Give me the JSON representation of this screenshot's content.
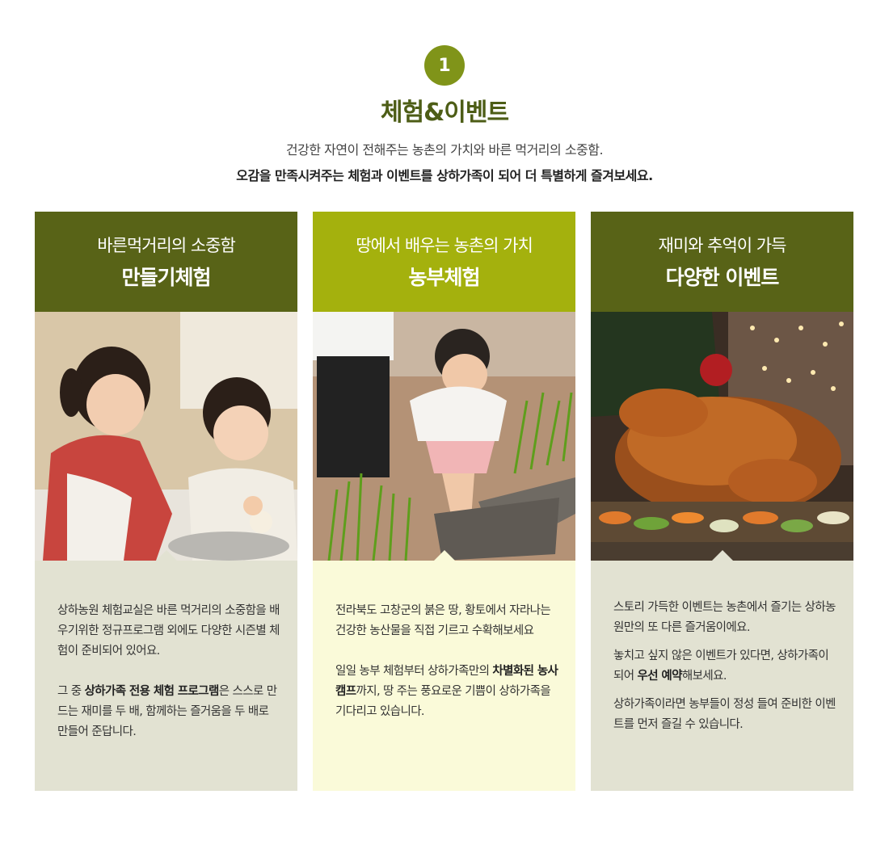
{
  "header": {
    "number": "1",
    "title": "체험&이벤트",
    "intro_line1": "건강한 자연이 전해주는 농촌의 가치와 바른 먹거리의 소중함.",
    "intro_line2": "오감을 만족시켜주는 체험과 이벤트를 상하가족이 되어  더 특별하게 즐겨보세요."
  },
  "cards": [
    {
      "subtitle": "바른먹거리의 소중함",
      "title": "만들기체험",
      "photo_icon": "kids-cooking-photo",
      "paragraphs": [
        [
          {
            "text": "상하농원 체험교실은 바른 먹거리의 소중함을 배우기위한 정규프로그램 외에도 다양한 시즌별 체험이 준비되어 있어요."
          }
        ],
        [
          {
            "text": "그 중 "
          },
          {
            "text": "상하가족 전용 체험 프로그램",
            "bold": true
          },
          {
            "text": "은 스스로 만드는 재미를 두 배, 함께하는 즐거움을 두 배로 만들어 준답니다."
          }
        ]
      ]
    },
    {
      "subtitle": "땅에서 배우는 농촌의 가치",
      "title": "농부체험",
      "photo_icon": "rice-planting-photo",
      "paragraphs": [
        [
          {
            "text": "전라북도 고창군의 붉은 땅, 황토에서 자라나는 건강한 농산물을 직접 기르고 수확해보세요"
          }
        ],
        [
          {
            "text": "일일 농부 체험부터 상하가족만의 "
          },
          {
            "text": "차별화된 농사 캠프",
            "bold": true
          },
          {
            "text": "까지, 땅 주는 풍요로운 기쁨이 상하가족을 기다리고 있습니다."
          }
        ]
      ]
    },
    {
      "subtitle": "재미와 추억이 가득",
      "title": "다양한 이벤트",
      "photo_icon": "roast-chicken-photo",
      "paragraphs": [
        [
          {
            "text": "스토리 가득한 이벤트는 농촌에서 즐기는 상하농원만의 또 다른 즐거움이에요."
          }
        ],
        [
          {
            "text": "놓치고 싶지 않은 이벤트가 있다면, 상하가족이 되어 "
          },
          {
            "text": "우선 예약",
            "bold": true
          },
          {
            "text": "해보세요."
          }
        ],
        [
          {
            "text": "상하가족이라면 농부들이 정성 들여 준비한 이벤트를 먼저 즐길 수 있습니다."
          }
        ]
      ]
    }
  ],
  "colors": {
    "olive_dark": "#586317",
    "olive_light": "#a4b10d",
    "badge": "#809419",
    "title": "#4d5d16",
    "body_gray": "#e2e2d2",
    "body_yellow": "#fafad9"
  }
}
